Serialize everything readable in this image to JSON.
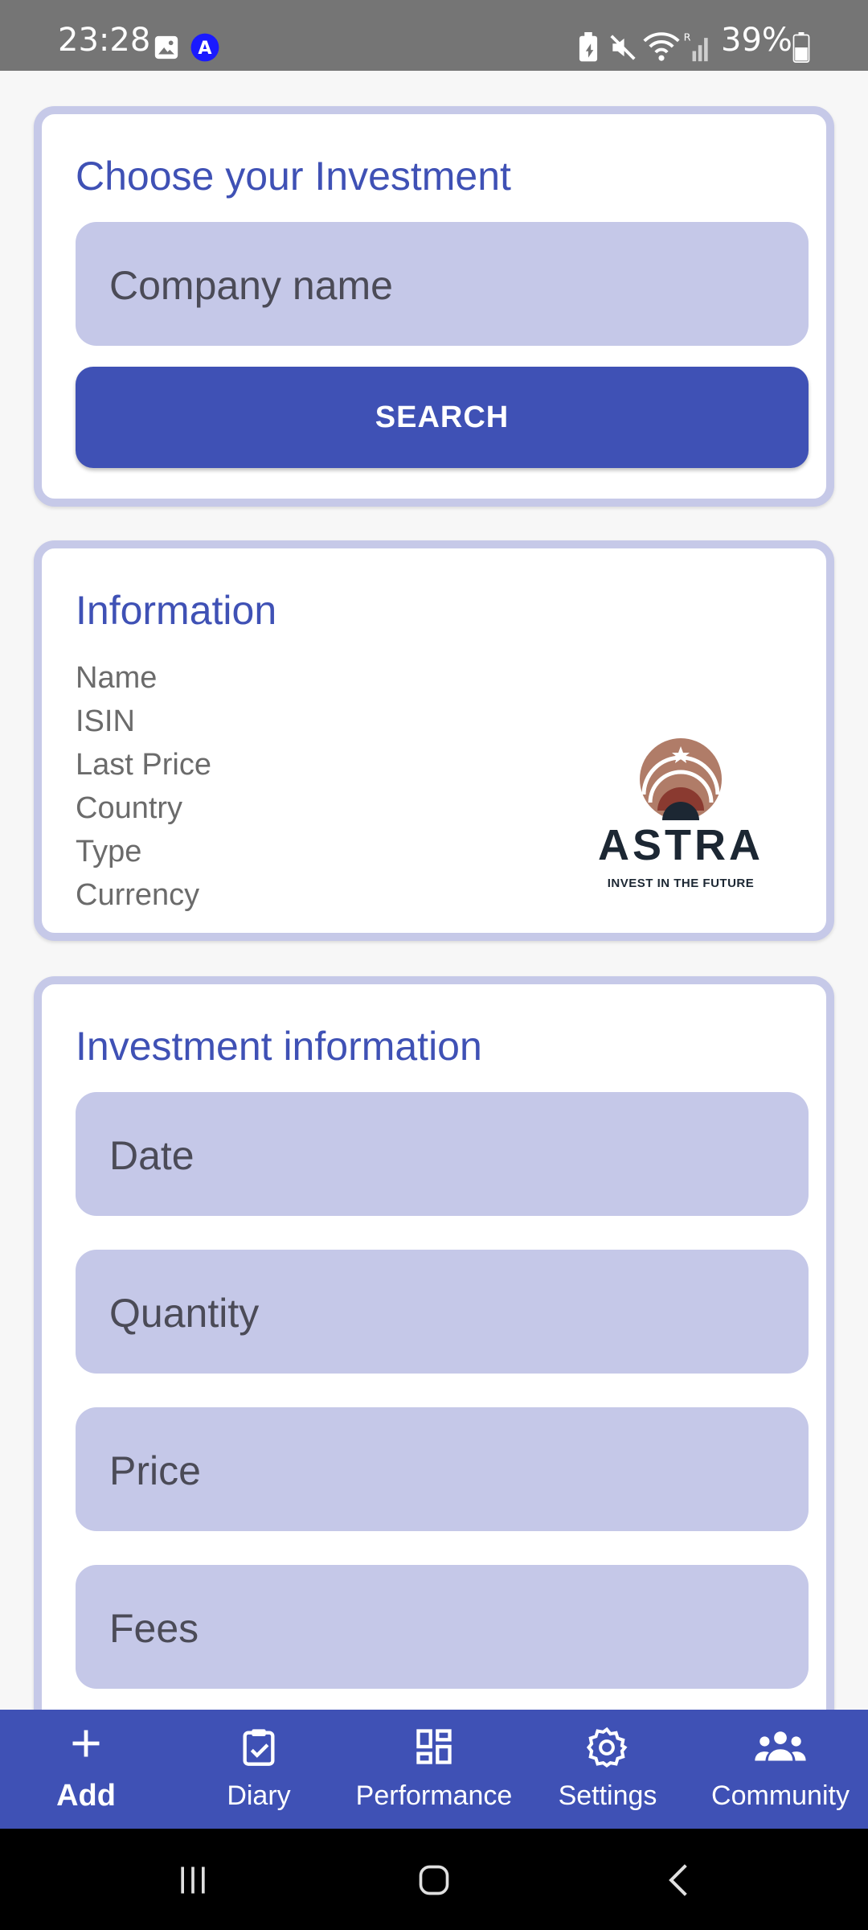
{
  "status_bar": {
    "time": "23:28",
    "battery": "39%",
    "icons": [
      "image-icon",
      "a-badge-icon",
      "battery-saver-icon",
      "mute-icon",
      "wifi-icon",
      "signal-icon",
      "battery-icon"
    ]
  },
  "search_card": {
    "title": "Choose your Investment",
    "company_placeholder": "Company name",
    "search_label": "SEARCH"
  },
  "info_card": {
    "title": "Information",
    "labels": [
      "Name",
      "ISIN",
      "Last Price",
      "Country",
      "Type",
      "Currency"
    ],
    "logo": {
      "word": "ASTRA",
      "tagline": "INVEST IN THE FUTURE"
    }
  },
  "investment_card": {
    "title": "Investment information",
    "fields": [
      "Date",
      "Quantity",
      "Price",
      "Fees"
    ]
  },
  "bottom_nav": {
    "items": [
      {
        "label": "Add",
        "icon": "plus-icon",
        "active": true
      },
      {
        "label": "Diary",
        "icon": "clipboard-check-icon",
        "active": false
      },
      {
        "label": "Performance",
        "icon": "dashboard-icon",
        "active": false
      },
      {
        "label": "Settings",
        "icon": "gear-icon",
        "active": false
      },
      {
        "label": "Community",
        "icon": "people-icon",
        "active": false
      }
    ]
  },
  "colors": {
    "primary": "#3f51b5",
    "field_background": "#c5c8e8",
    "card_border": "#c6c9e8",
    "status_bar": "#757575"
  }
}
